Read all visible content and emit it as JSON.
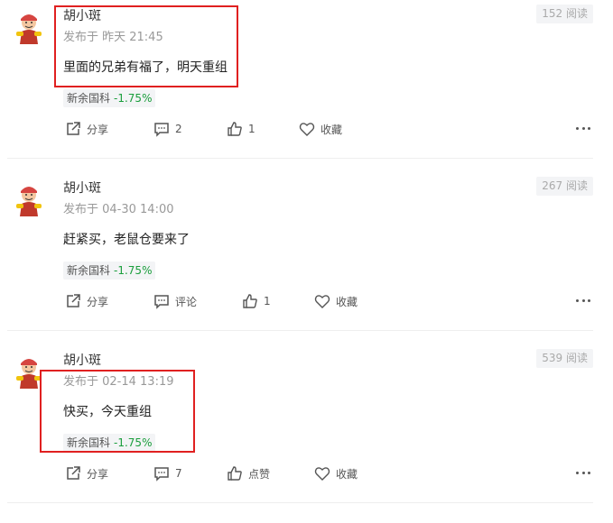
{
  "posts": [
    {
      "author": "胡小斑",
      "meta": "发布于 昨天 21:45",
      "content": "里面的兄弟有福了，明天重组",
      "stock_name": "新余国科",
      "stock_change": "-1.75%",
      "reads": "152 阅读",
      "share_label": "分享",
      "comment_label": "2",
      "like_label": "1",
      "favorite_label": "收藏"
    },
    {
      "author": "胡小斑",
      "meta": "发布于 04-30 14:00",
      "content": "赶紧买，老鼠仓要来了",
      "stock_name": "新余国科",
      "stock_change": "-1.75%",
      "reads": "267 阅读",
      "share_label": "分享",
      "comment_label": "评论",
      "like_label": "1",
      "favorite_label": "收藏"
    },
    {
      "author": "胡小斑",
      "meta": "发布于 02-14 13:19",
      "content": "快买，今天重组",
      "stock_name": "新余国科",
      "stock_change": "-1.75%",
      "reads": "539 阅读",
      "share_label": "分享",
      "comment_label": "7",
      "like_label": "点赞",
      "favorite_label": "收藏"
    }
  ],
  "colors": {
    "highlight": "#e02020",
    "stock_down": "#1a9e3c",
    "muted": "#999999"
  }
}
